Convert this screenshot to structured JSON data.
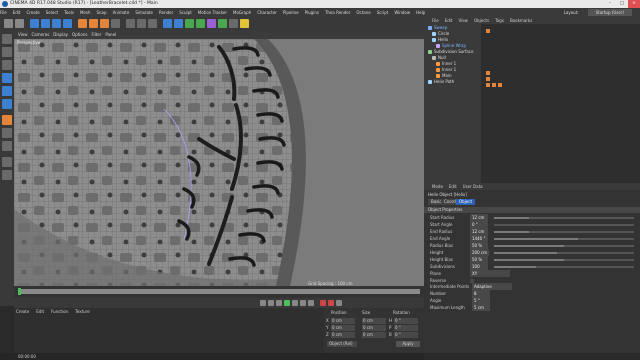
{
  "title": "CINEMA 4D R17.048 Studio (R17) - [LeatherBracelet.c4d *] - Main",
  "window_controls": {
    "minimize": "–",
    "maximize": "□",
    "close": "×"
  },
  "menu": [
    "File",
    "Edit",
    "Create",
    "Select",
    "Tools",
    "Mesh",
    "Snap",
    "Animate",
    "Simulate",
    "Render",
    "Sculpt",
    "Motion Tracker",
    "MoGraph",
    "Character",
    "Pipeline",
    "Plugins",
    "Thea Render",
    "Octane",
    "Script",
    "Window",
    "Help"
  ],
  "layout": {
    "label": "Layout:",
    "value": "Startup (User)"
  },
  "viewport": {
    "menu": [
      "View",
      "Cameras",
      "Display",
      "Options",
      "Filter",
      "Panel"
    ],
    "label": "Perspective",
    "grid_spacing": "Grid Spacing : 100 cm"
  },
  "material_manager": {
    "menu": [
      "Create",
      "Edit",
      "Function",
      "Texture"
    ]
  },
  "coordinates": {
    "headers": [
      "Position",
      "Size",
      "Rotation"
    ],
    "rows": [
      {
        "axis": "X",
        "pos": "0 cm",
        "size": "0 cm",
        "rot_axis": "H",
        "rot": "0 °"
      },
      {
        "axis": "Y",
        "pos": "0 cm",
        "size": "0 cm",
        "rot_axis": "P",
        "rot": "0 °"
      },
      {
        "axis": "Z",
        "pos": "0 cm",
        "size": "0 cm",
        "rot_axis": "B",
        "rot": "0 °"
      }
    ],
    "mode": "Object (Rel)",
    "apply": "Apply"
  },
  "status": "00:00:00",
  "object_manager": {
    "menu": [
      "File",
      "Edit",
      "View",
      "Objects",
      "Tags",
      "Bookmarks"
    ],
    "objects": [
      {
        "name": "Sweep",
        "selected": true,
        "color": "#7fb2ff"
      },
      {
        "name": "Circle",
        "selected": false,
        "color": "#9fd4ff"
      },
      {
        "name": "Helix",
        "selected": false,
        "color": "#9fd4ff"
      },
      {
        "name": "Spline Wrap",
        "selected": true,
        "color": "#c8a0ff"
      },
      {
        "name": "Subdivision Surface",
        "selected": false,
        "color": "#8fd08f"
      },
      {
        "name": "Null",
        "selected": false,
        "color": "#bbbbbb"
      },
      {
        "name": "Inner 1",
        "selected": false,
        "color": "#ff9a3c"
      },
      {
        "name": "Inner 1",
        "selected": false,
        "color": "#ff9a3c"
      },
      {
        "name": "Main",
        "selected": false,
        "color": "#ff9a3c"
      },
      {
        "name": "Helix Path",
        "selected": false,
        "color": "#9fd4ff"
      }
    ]
  },
  "attributes": {
    "menu": [
      "Mode",
      "Edit",
      "User Data"
    ],
    "object_title": "Helix Object [Helix]",
    "tabs": [
      "Basic",
      "Coord.",
      "Object"
    ],
    "active_tab": "Object",
    "section": "Object Properties",
    "props": [
      {
        "label": "Start Radius",
        "value": "12 cm",
        "fill": 0.25
      },
      {
        "label": "Start Angle",
        "value": "0 °",
        "fill": 0.0
      },
      {
        "label": "End Radius",
        "value": "12 cm",
        "fill": 0.25
      },
      {
        "label": "End Angle",
        "value": "1440 °",
        "fill": 0.6
      },
      {
        "label": "Radius Bias",
        "value": "50 %",
        "fill": 0.5
      },
      {
        "label": "Height",
        "value": "200 cm",
        "fill": 0.45
      },
      {
        "label": "Height Bias",
        "value": "50 %",
        "fill": 0.5
      },
      {
        "label": "Subdivisions",
        "value": "100",
        "fill": 0.3
      },
      {
        "label": "Plane",
        "value": "XY",
        "fill": null
      },
      {
        "label": "Reverse",
        "value": "",
        "fill": null
      }
    ],
    "interp": [
      {
        "label": "Intermediate Points",
        "value": "Adaptive"
      },
      {
        "label": "Number",
        "value": "8"
      },
      {
        "label": "Angle",
        "value": "5 °"
      },
      {
        "label": "Maximum Length",
        "value": "5 cm"
      }
    ]
  },
  "colors": {
    "accent": "#2b62b8",
    "keyframe": "#49c25a",
    "icon_orange": "#e2843a",
    "icon_blue": "#3d7fd0"
  }
}
